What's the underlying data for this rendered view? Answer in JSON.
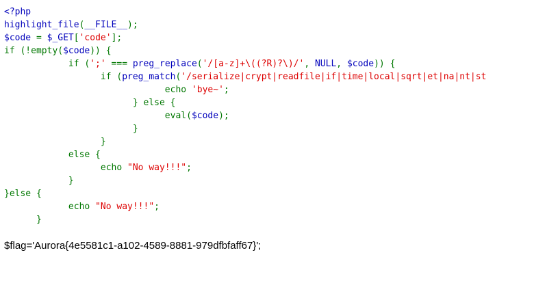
{
  "colors": {
    "default": "#0000BB",
    "keyword": "#007700",
    "string": "#DD0000"
  },
  "code_lines": [
    [
      {
        "t": "<?php",
        "c": "default"
      }
    ],
    [
      {
        "t": "highlight_file",
        "c": "default"
      },
      {
        "t": "(",
        "c": "keyword"
      },
      {
        "t": "__FILE__",
        "c": "default"
      },
      {
        "t": ");",
        "c": "keyword"
      }
    ],
    [
      {
        "t": "$code ",
        "c": "default"
      },
      {
        "t": "= ",
        "c": "keyword"
      },
      {
        "t": "$_GET",
        "c": "default"
      },
      {
        "t": "[",
        "c": "keyword"
      },
      {
        "t": "'code'",
        "c": "string"
      },
      {
        "t": "];",
        "c": "keyword"
      }
    ],
    [
      {
        "t": "if (!empty(",
        "c": "keyword"
      },
      {
        "t": "$code",
        "c": "default"
      },
      {
        "t": ")) {",
        "c": "keyword"
      }
    ],
    [
      {
        "t": "            if (",
        "c": "keyword"
      },
      {
        "t": "';' ",
        "c": "string"
      },
      {
        "t": "=== ",
        "c": "keyword"
      },
      {
        "t": "preg_replace",
        "c": "default"
      },
      {
        "t": "(",
        "c": "keyword"
      },
      {
        "t": "'/[a-z]+\\((?R)?\\)/'",
        "c": "string"
      },
      {
        "t": ", ",
        "c": "keyword"
      },
      {
        "t": "NULL",
        "c": "default"
      },
      {
        "t": ", ",
        "c": "keyword"
      },
      {
        "t": "$code",
        "c": "default"
      },
      {
        "t": ")) {",
        "c": "keyword"
      }
    ],
    [
      {
        "t": "                  if (",
        "c": "keyword"
      },
      {
        "t": "preg_match",
        "c": "default"
      },
      {
        "t": "(",
        "c": "keyword"
      },
      {
        "t": "'/serialize|crypt|readfile|if|time|local|sqrt|et|na|nt|st",
        "c": "string"
      }
    ],
    [
      {
        "t": "                              echo ",
        "c": "keyword"
      },
      {
        "t": "'bye~'",
        "c": "string"
      },
      {
        "t": ";",
        "c": "keyword"
      }
    ],
    [
      {
        "t": "                        } else {",
        "c": "keyword"
      }
    ],
    [
      {
        "t": "                              eval",
        "c": "keyword"
      },
      {
        "t": "(",
        "c": "keyword"
      },
      {
        "t": "$code",
        "c": "default"
      },
      {
        "t": ");",
        "c": "keyword"
      }
    ],
    [
      {
        "t": "                        }",
        "c": "keyword"
      }
    ],
    [
      {
        "t": "                  }",
        "c": "keyword"
      }
    ],
    [
      {
        "t": "            else {",
        "c": "keyword"
      }
    ],
    [
      {
        "t": "                  echo ",
        "c": "keyword"
      },
      {
        "t": "\"No way!!!\"",
        "c": "string"
      },
      {
        "t": ";",
        "c": "keyword"
      }
    ],
    [
      {
        "t": "            }",
        "c": "keyword"
      }
    ],
    [
      {
        "t": "}else {",
        "c": "keyword"
      }
    ],
    [
      {
        "t": "            echo ",
        "c": "keyword"
      },
      {
        "t": "\"No way!!!\"",
        "c": "string"
      },
      {
        "t": ";",
        "c": "keyword"
      }
    ],
    [
      {
        "t": "      }",
        "c": "keyword"
      }
    ]
  ],
  "flag_text": "$flag='Aurora{4e5581c1-a102-4589-8881-979dfbfaff67}';"
}
